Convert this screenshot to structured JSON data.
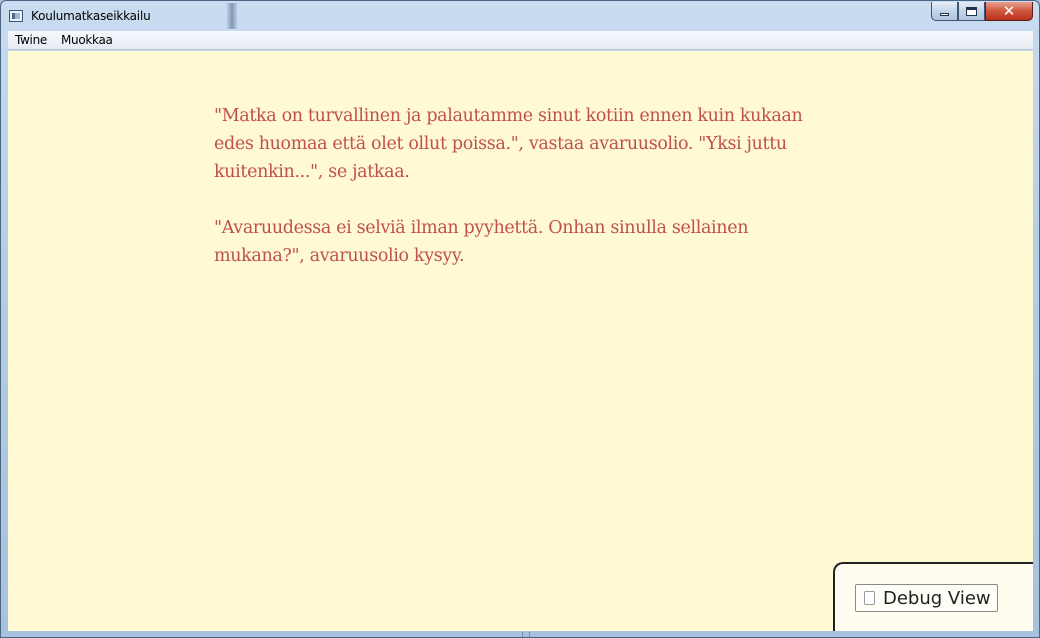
{
  "window": {
    "title": "Koulumatkaseikkailu",
    "icons": {
      "app": "app-window-icon",
      "minimize": "minimize-icon",
      "maximize": "maximize-icon",
      "close": "close-icon"
    },
    "close_glyph": "✕"
  },
  "menubar": {
    "items": [
      {
        "label": "Twine"
      },
      {
        "label": "Muokkaa"
      }
    ]
  },
  "story": {
    "paragraphs": [
      "\"Matka on turvallinen ja palautamme sinut kotiin ennen kuin kukaan edes huomaa että olet ollut poissa.\", vastaa avaruusolio. \"Yksi juttu kuitenkin...\", se jatkaa.",
      "\"Avaruudessa ei selviä ilman pyyhettä. Onhan sinulla sellainen mukana?\", avaruusolio kysyy."
    ],
    "text_color": "#c0504d",
    "background_color": "#fff9d4"
  },
  "debug": {
    "label": "Debug View",
    "checked": false
  }
}
